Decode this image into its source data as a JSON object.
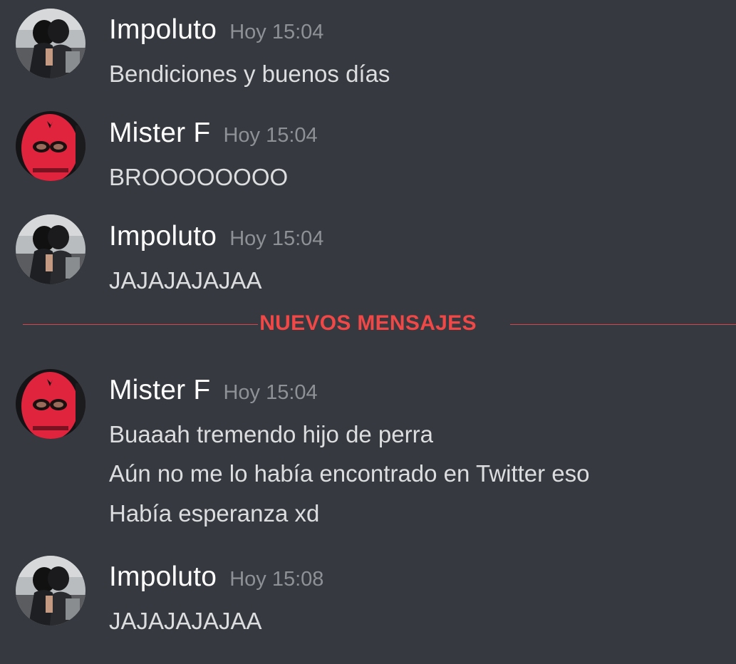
{
  "divider": {
    "label": "NUEVOS MENSAJES",
    "color": "#f04747"
  },
  "messages": [
    {
      "author": "Impoluto",
      "time": "Hoy 15:04",
      "avatar": "helmet-couple-avatar",
      "lines": [
        "Bendiciones y buenos días"
      ]
    },
    {
      "author": "Mister F",
      "time": "Hoy 15:04",
      "avatar": "red-balaclava-avatar",
      "lines": [
        "BROOOOOOOO"
      ]
    },
    {
      "author": "Impoluto",
      "time": "Hoy 15:04",
      "avatar": "helmet-couple-avatar",
      "lines": [
        "JAJAJAJAJAA"
      ]
    },
    {
      "author": "Mister F",
      "time": "Hoy 15:04",
      "avatar": "red-balaclava-avatar",
      "lines": [
        "Buaaah tremendo hijo de perra",
        "Aún no me lo había encontrado en Twitter eso",
        "Había esperanza xd"
      ]
    },
    {
      "author": "Impoluto",
      "time": "Hoy 15:08",
      "avatar": "helmet-couple-avatar",
      "lines": [
        "JAJAJAJAJAA"
      ]
    }
  ],
  "colors": {
    "background": "#36393f",
    "username": "#ffffff",
    "timestamp": "#8e9297",
    "text": "#dcddde"
  }
}
